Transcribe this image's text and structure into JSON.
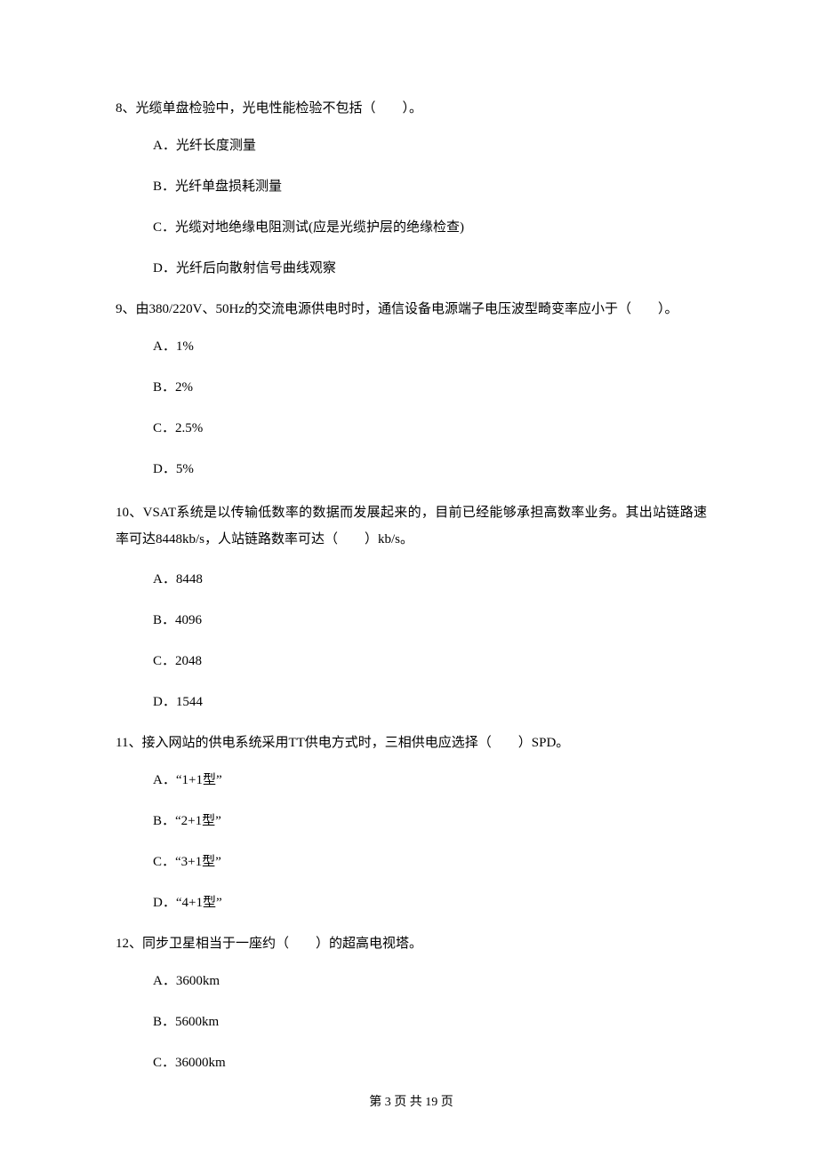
{
  "q8": {
    "text": "8、光缆单盘检验中，光电性能检验不包括（　　）。",
    "a": "A．光纤长度测量",
    "b": "B．光纤单盘损耗测量",
    "c": "C．光缆对地绝缘电阻测试(应是光缆护层的绝缘检查)",
    "d": "D．光纤后向散射信号曲线观察"
  },
  "q9": {
    "text": "9、由380/220V、50Hz的交流电源供电时时，通信设备电源端子电压波型畸变率应小于（　　）。",
    "a": "A．1%",
    "b": "B．2%",
    "c": "C．2.5%",
    "d": "D．5%"
  },
  "q10": {
    "text": "10、VSAT系统是以传输低数率的数据而发展起来的，目前已经能够承担高数率业务。其出站链路速率可达8448kb/s，人站链路数率可达（　　）kb/s。",
    "a": "A．8448",
    "b": "B．4096",
    "c": "C．2048",
    "d": "D．1544"
  },
  "q11": {
    "text": "11、接入网站的供电系统采用TT供电方式时，三相供电应选择（　　）SPD。",
    "a": "A．“1+1型”",
    "b": "B．“2+1型”",
    "c": "C．“3+1型”",
    "d": "D．“4+1型”"
  },
  "q12": {
    "text": "12、同步卫星相当于一座约（　　）的超高电视塔。",
    "a": "A．3600km",
    "b": "B．5600km",
    "c": "C．36000km"
  },
  "footer": "第 3 页 共 19 页"
}
